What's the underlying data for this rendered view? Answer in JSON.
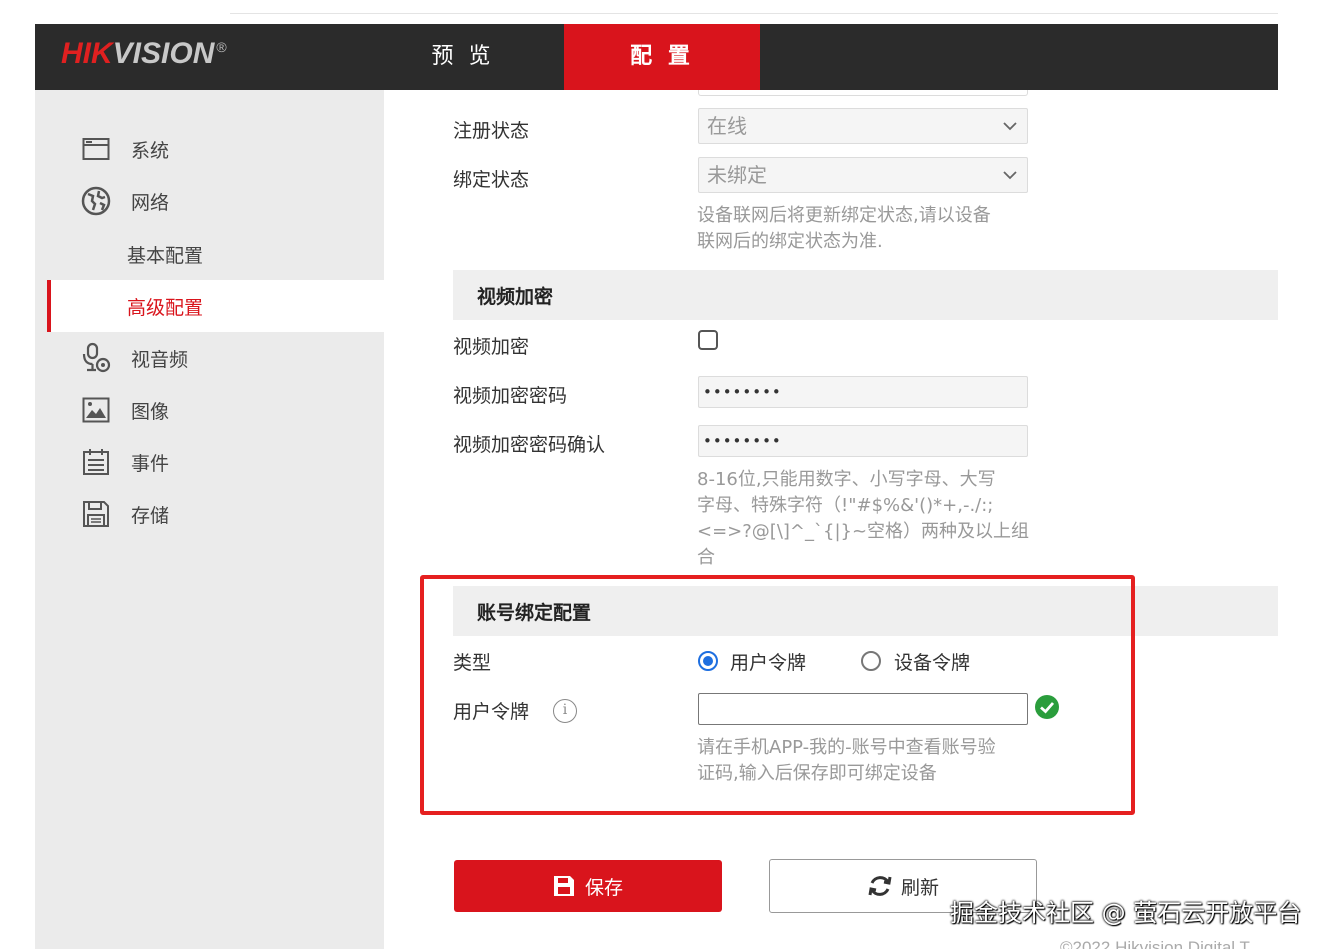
{
  "header": {
    "logo_main": "HIK",
    "logo_rest": "VISION",
    "logo_mark": "®",
    "tabs": [
      {
        "label": "预 览",
        "active": false
      },
      {
        "label": "配 置",
        "active": true
      }
    ]
  },
  "sidebar": {
    "items": [
      {
        "label": "系统",
        "icon": "system-window-icon"
      },
      {
        "label": "网络",
        "icon": "globe-icon"
      },
      {
        "label": "基本配置",
        "sub": true
      },
      {
        "label": "高级配置",
        "sub": true,
        "active": true
      },
      {
        "label": "视音频",
        "icon": "microphone-icon"
      },
      {
        "label": "图像",
        "icon": "image-icon"
      },
      {
        "label": "事件",
        "icon": "calendar-list-icon"
      },
      {
        "label": "存储",
        "icon": "floppy-disk-icon"
      }
    ]
  },
  "form": {
    "register_status": {
      "label": "注册状态",
      "value": "在线"
    },
    "bind_status": {
      "label": "绑定状态",
      "value": "未绑定"
    },
    "bind_hint_1": "设备联网后将更新绑定状态,请以设备",
    "bind_hint_2": "联网后的绑定状态为准.",
    "video_encrypt_section": "视频加密",
    "video_encrypt": {
      "label": "视频加密",
      "checked": false
    },
    "video_encrypt_pw": {
      "label": "视频加密密码",
      "value": "••••••••"
    },
    "video_encrypt_pw_confirm": {
      "label": "视频加密密码确认",
      "value": "••••••••"
    },
    "pw_hint_1": "8-16位,只能用数字、小写字母、大写",
    "pw_hint_2": "字母、特殊字符（!\"#$%&'()*+,-./:;",
    "pw_hint_3": "<=>?@[\\]^_`{|}~空格）两种及以上组",
    "pw_hint_4": "合",
    "account_bind_section": "账号绑定配置",
    "type": {
      "label": "类型",
      "options": [
        "用户令牌",
        "设备令牌"
      ],
      "selected": "用户令牌"
    },
    "user_token": {
      "label": "用户令牌",
      "value": "",
      "info_glyph": "i"
    },
    "token_hint_1": "请在手机APP-我的-账号中查看账号验",
    "token_hint_2": "证码,输入后保存即可绑定设备"
  },
  "buttons": {
    "save": "保存",
    "refresh": "刷新"
  },
  "watermark": "掘金技术社区 @ 萤石云开放平台",
  "footer": "©2022 Hikvision Digital T",
  "colors": {
    "brand_red": "#d9141c",
    "header_bg": "#2b2b2b",
    "sidebar_bg": "#ebebeb",
    "radio_blue": "#1e6fe0",
    "ok_green": "#2a9d3c",
    "highlight_red": "#e52020"
  }
}
